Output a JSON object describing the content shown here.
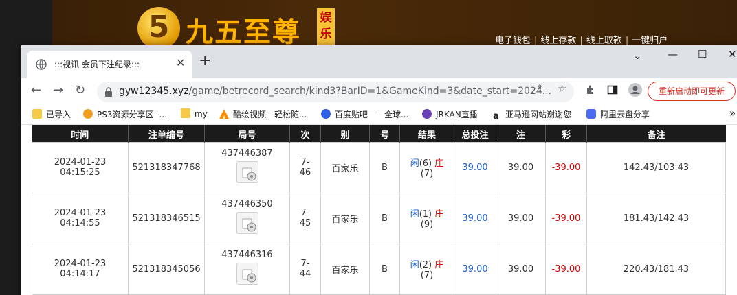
{
  "background_site": {
    "logo_glyph": "5",
    "logo_text": "九五至尊",
    "logo_tag": "娱乐",
    "nav": [
      "电子钱包",
      "线上存款",
      "线上取款",
      "一键归户"
    ]
  },
  "browser": {
    "tab_title": ":::视讯 会员下注纪录:::",
    "url_host": "gyw12345.xyz",
    "url_path": "/game/betrecord_search/kind3?BarID=1&GameKind=3&date_start=2024...",
    "update_button": "重新启动即可更新",
    "bookmarks": [
      "已导入",
      "PS3资源分享区 -...",
      "my",
      "酷绘视频 - 轻松随...",
      "百度贴吧——全球...",
      "JRKAN直播",
      "亚马逊网站谢谢您",
      "阿里云盘分享"
    ],
    "more_bookmarks": "»"
  },
  "table": {
    "headers": [
      "时间",
      "注单编号",
      "局号",
      "次",
      "别",
      "号",
      "结果",
      "总投注",
      "注",
      "彩",
      "备注"
    ],
    "rows": [
      {
        "time_date": "2024-01-23",
        "time_clock": "04:15:25",
        "order": "521318347768",
        "round": "437446387",
        "seq_a": "7-",
        "seq_b": "46",
        "game": "百家乐",
        "table": "B",
        "res_player": "闲",
        "res_player_pts": "(6)",
        "res_banker": "庄",
        "res_banker_pts": "(7)",
        "bet": "39.00",
        "valid": "39.00",
        "payout": "-39.00",
        "balance": "142.43/103.43"
      },
      {
        "time_date": "2024-01-23",
        "time_clock": "04:14:55",
        "order": "521318346515",
        "round": "437446350",
        "seq_a": "7-",
        "seq_b": "45",
        "game": "百家乐",
        "table": "B",
        "res_player": "闲",
        "res_player_pts": "(1)",
        "res_banker": "庄",
        "res_banker_pts": "(9)",
        "bet": "39.00",
        "valid": "39.00",
        "payout": "-39.00",
        "balance": "181.43/142.43"
      },
      {
        "time_date": "2024-01-23",
        "time_clock": "04:14:17",
        "order": "521318345056",
        "round": "437446316",
        "seq_a": "7-",
        "seq_b": "44",
        "game": "百家乐",
        "table": "B",
        "res_player": "闲",
        "res_player_pts": "(2)",
        "res_banker": "庄",
        "res_banker_pts": "(7)",
        "bet": "39.00",
        "valid": "39.00",
        "payout": "-39.00",
        "balance": "220.43/181.43"
      }
    ]
  },
  "colors": {
    "link_blue": "#1a5fcf",
    "loss_red": "#e00000",
    "header_bg": "#1b1b1b"
  }
}
